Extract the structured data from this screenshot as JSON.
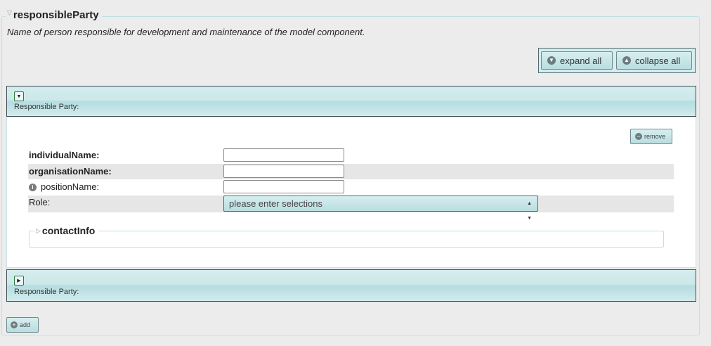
{
  "section": {
    "title": "responsibleParty",
    "description": "Name of person responsible for development and maintenance of the model component."
  },
  "toolbar": {
    "expand_all": "expand all",
    "collapse_all": "collapse all"
  },
  "parties": [
    {
      "label": "Responsible Party:",
      "expanded": true,
      "remove_label": "remove",
      "fields": {
        "individual_name": {
          "label": "individualName:",
          "value": ""
        },
        "organisation_name": {
          "label": "organisationName:",
          "value": ""
        },
        "position_name": {
          "label": "positionName:",
          "value": ""
        },
        "role": {
          "label": "Role:",
          "selected": "please enter selections"
        }
      },
      "contact_info": {
        "title": "contactInfo"
      }
    },
    {
      "label": "Responsible Party:",
      "expanded": false
    }
  ],
  "add_label": "add"
}
